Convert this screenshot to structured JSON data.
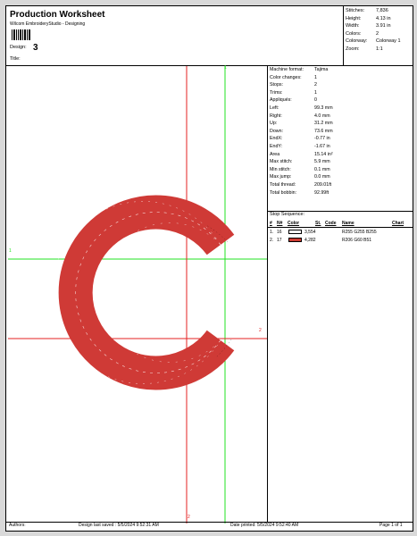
{
  "header": {
    "title": "Production Worksheet",
    "subtitle": "Wilcom EmbroideryStudio - Designing",
    "design_label": "Design:",
    "design_value": "3",
    "title_label": "Title:"
  },
  "stats": [
    {
      "key": "Stitches:",
      "value": "7,836"
    },
    {
      "key": "Height:",
      "value": "4.13 in"
    },
    {
      "key": "Width:",
      "value": "3.91 in"
    },
    {
      "key": "Colors:",
      "value": "2"
    },
    {
      "key": "Colorway:",
      "value": "Colorway 1"
    },
    {
      "key": "Zoom:",
      "value": "1:1"
    }
  ],
  "machine_info": [
    {
      "key": "Machine format:",
      "value": "Tajima"
    },
    {
      "key": "Color changes:",
      "value": "1"
    },
    {
      "key": "Stops:",
      "value": "2"
    },
    {
      "key": "Trims:",
      "value": "1"
    },
    {
      "key": "Appliqués:",
      "value": "0"
    },
    {
      "key": "Left:",
      "value": "99.3 mm"
    },
    {
      "key": "Right:",
      "value": "4.0 mm"
    },
    {
      "key": "Up:",
      "value": "31.2 mm"
    },
    {
      "key": "Down:",
      "value": "73.6 mm"
    },
    {
      "key": "EndX:",
      "value": "-0.77 in"
    },
    {
      "key": "EndY:",
      "value": "-1.67 in"
    },
    {
      "key": "Area",
      "value": "15.14 in²"
    },
    {
      "key": "Max stitch:",
      "value": "5.9 mm"
    },
    {
      "key": "Min stitch:",
      "value": "0.1 mm"
    },
    {
      "key": "Max jump:",
      "value": "0.0 mm"
    },
    {
      "key": "Total thread:",
      "value": "209.01ft"
    },
    {
      "key": "Total bobbin:",
      "value": "92.99ft"
    }
  ],
  "stop_sequence": {
    "label": "Stop Sequence:",
    "columns": {
      "num": "#",
      "n": "N#",
      "color": "Color",
      "st": "St.",
      "code": "Code",
      "name": "Name",
      "chart": "Chart"
    },
    "rows": [
      {
        "num": "1.",
        "n": "16",
        "swatch": "#ffffff",
        "st": "3,554",
        "name": "R255 G255 B255"
      },
      {
        "num": "2.",
        "n": "17",
        "swatch": "#ce3c33",
        "st": "4,282",
        "name": "R206 G60 B51"
      }
    ]
  },
  "canvas": {
    "marker_1_top": "1",
    "marker_1_left": "1",
    "marker_2_bottom": "2",
    "marker_2_right": "2",
    "design_color": "#cf3a36",
    "grid_green": "#22e322",
    "grid_red": "#e52222"
  },
  "footer": {
    "authors_label": "Authors:",
    "saved": "Design last saved : 5/5/2024 9:52:31 AM",
    "printed": "Date printed: 5/5/2024 9:52:40 AM",
    "page": "Page 1 of 1"
  },
  "icons": {
    "barcode": "barcode-icon"
  }
}
